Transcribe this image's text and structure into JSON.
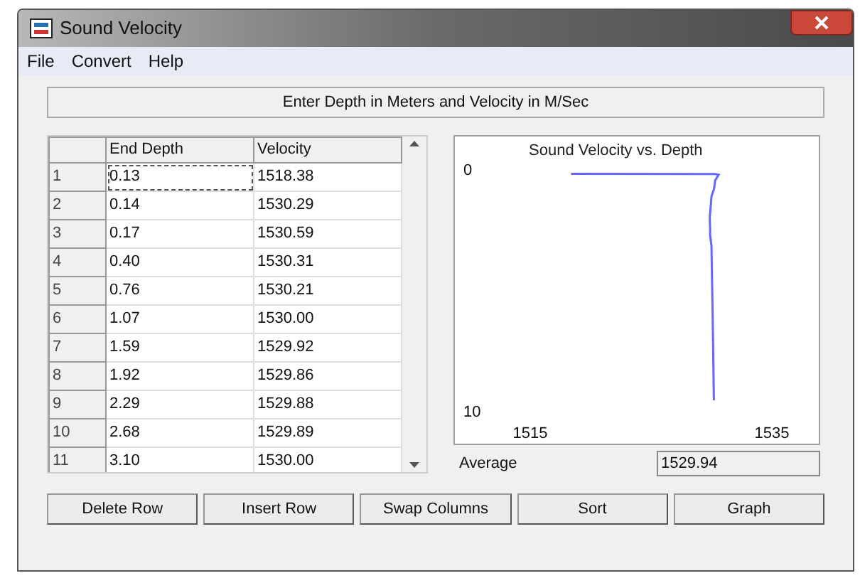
{
  "window": {
    "title": "Sound Velocity"
  },
  "menu": [
    "File",
    "Convert",
    "Help"
  ],
  "instruction": "Enter Depth in Meters and Velocity in M/Sec",
  "table": {
    "columns": [
      "End Depth",
      "Velocity"
    ],
    "rows": [
      {
        "index": "1",
        "depth": "0.13",
        "velocity": "1518.38",
        "selected": true
      },
      {
        "index": "2",
        "depth": "0.14",
        "velocity": "1530.29",
        "selected": false
      },
      {
        "index": "3",
        "depth": "0.17",
        "velocity": "1530.59",
        "selected": false
      },
      {
        "index": "4",
        "depth": "0.40",
        "velocity": "1530.31",
        "selected": false
      },
      {
        "index": "5",
        "depth": "0.76",
        "velocity": "1530.21",
        "selected": false
      },
      {
        "index": "6",
        "depth": "1.07",
        "velocity": "1530.00",
        "selected": false
      },
      {
        "index": "7",
        "depth": "1.59",
        "velocity": "1529.92",
        "selected": false
      },
      {
        "index": "8",
        "depth": "1.92",
        "velocity": "1529.86",
        "selected": false
      },
      {
        "index": "9",
        "depth": "2.29",
        "velocity": "1529.88",
        "selected": false
      },
      {
        "index": "10",
        "depth": "2.68",
        "velocity": "1529.89",
        "selected": false
      },
      {
        "index": "11",
        "depth": "3.10",
        "velocity": "1530.00",
        "selected": false
      }
    ]
  },
  "chart": {
    "chart_data": {
      "type": "line",
      "title": "Sound Velocity vs. Depth",
      "x": [
        1518.38,
        1530.29,
        1530.59,
        1530.31,
        1530.21,
        1530.0,
        1529.92,
        1529.86,
        1529.88,
        1529.89,
        1530.0,
        1530.1,
        1530.2
      ],
      "series": [
        {
          "color": "#6666ff",
          "values": [
            0.13,
            0.14,
            0.17,
            0.4,
            0.76,
            1.07,
            1.59,
            1.92,
            2.29,
            2.68,
            3.1,
            6.0,
            9.5
          ]
        }
      ],
      "xlim": [
        1515,
        1535
      ],
      "ylim": [
        10,
        0
      ],
      "xticks": [
        1515,
        1535
      ],
      "yticks": [
        0,
        10
      ]
    }
  },
  "average": {
    "label": "Average",
    "value": "1529.94"
  },
  "buttons": [
    "Delete Row",
    "Insert Row",
    "Swap Columns",
    "Sort",
    "Graph"
  ]
}
